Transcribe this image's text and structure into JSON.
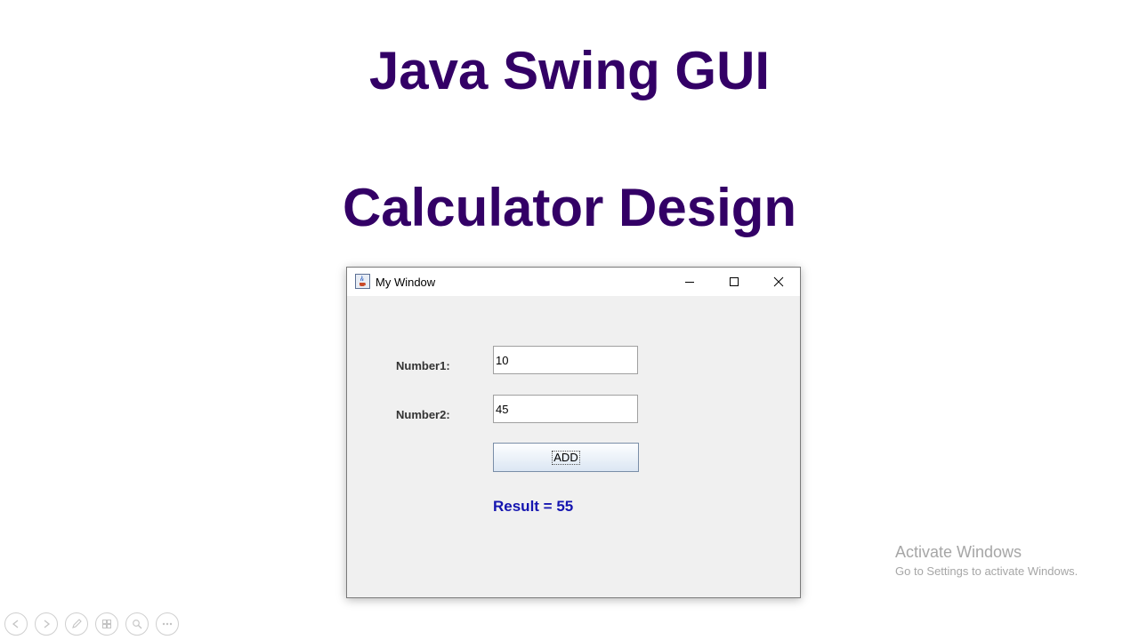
{
  "slide": {
    "title_line1": "Java Swing GUI",
    "title_line2": "Calculator Design",
    "title_color": "#330066"
  },
  "window": {
    "title": "My Window",
    "app_icon": "java-cup-icon",
    "controls": [
      "minimize-icon",
      "maximize-icon",
      "close-icon"
    ],
    "fields": [
      {
        "label": "Number1:",
        "value": "10"
      },
      {
        "label": "Number2:",
        "value": "45"
      }
    ],
    "add_button_label": "ADD",
    "result_text": "Result = 55",
    "result_color": "#1515b0",
    "background_color": "#f0f0f0"
  },
  "watermark": {
    "line1": "Activate Windows",
    "line2": "Go to Settings to activate Windows."
  },
  "presentation_controls": [
    "previous-icon",
    "next-icon",
    "pen-icon",
    "slides-icon",
    "zoom-icon",
    "more-icon"
  ]
}
